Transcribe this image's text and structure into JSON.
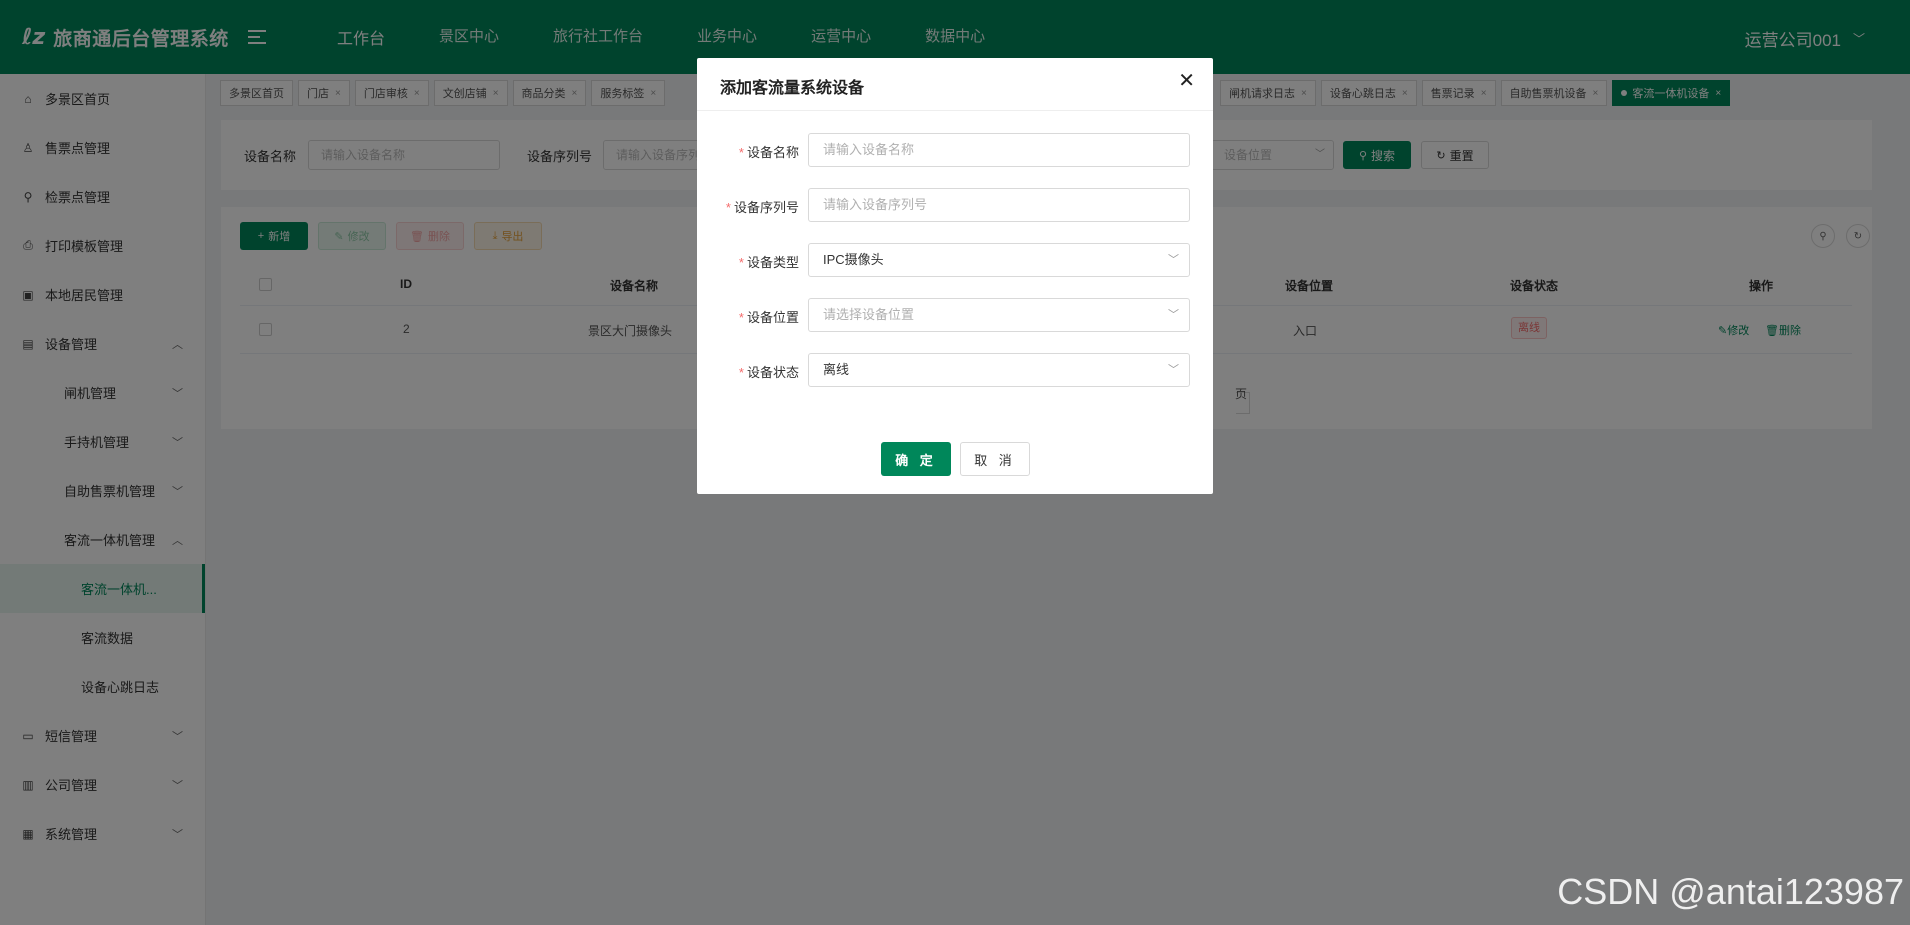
{
  "app": {
    "logo_mark": "lz",
    "title": "旅商通后台管理系统"
  },
  "top_nav": [
    "工作台",
    "景区中心",
    "旅行社工作台",
    "业务中心",
    "运营中心",
    "数据中心"
  ],
  "user": {
    "name": "运营公司001"
  },
  "sidebar": {
    "items": [
      {
        "label": "多景区首页"
      },
      {
        "label": "售票点管理"
      },
      {
        "label": "检票点管理"
      },
      {
        "label": "打印模板管理"
      },
      {
        "label": "本地居民管理"
      },
      {
        "label": "设备管理"
      },
      {
        "label": "闸机管理"
      },
      {
        "label": "手持机管理"
      },
      {
        "label": "自助售票机管理"
      },
      {
        "label": "客流一体机管理"
      },
      {
        "label": "客流一体机..."
      },
      {
        "label": "客流数据"
      },
      {
        "label": "设备心跳日志"
      },
      {
        "label": "短信管理"
      },
      {
        "label": "公司管理"
      },
      {
        "label": "系统管理"
      }
    ]
  },
  "tabs": [
    {
      "label": "多景区首页"
    },
    {
      "label": "门店"
    },
    {
      "label": "门店审核"
    },
    {
      "label": "文创店铺"
    },
    {
      "label": "商品分类"
    },
    {
      "label": "服务标签"
    },
    {
      "label": "闸机请求日志"
    },
    {
      "label": "设备心跳日志"
    },
    {
      "label": "售票记录"
    },
    {
      "label": "自助售票机设备"
    },
    {
      "label": "客流一体机设备"
    }
  ],
  "search": {
    "name_label": "设备名称",
    "name_placeholder": "请输入设备名称",
    "serial_label": "设备序列号",
    "serial_placeholder": "请输入设备序列号",
    "location_placeholder": "设备位置",
    "search_btn": "搜索",
    "reset_btn": "重置"
  },
  "toolbar": {
    "add": "新增",
    "edit": "修改",
    "delete": "删除",
    "export": "导出"
  },
  "table": {
    "headers": {
      "id": "ID",
      "name": "设备名称",
      "location": "设备位置",
      "status": "设备状态",
      "ops": "操作"
    },
    "rows": [
      {
        "id": "2",
        "name": "景区大门摄像头",
        "location": "入口",
        "status": "离线",
        "edit": "修改",
        "delete": "删除"
      }
    ],
    "pagination_suffix": "页"
  },
  "dialog": {
    "title": "添加客流量系统设备",
    "fields": {
      "name": {
        "label": "设备名称",
        "placeholder": "请输入设备名称"
      },
      "serial": {
        "label": "设备序列号",
        "placeholder": "请输入设备序列号"
      },
      "type": {
        "label": "设备类型",
        "value": "IPC摄像头"
      },
      "location": {
        "label": "设备位置",
        "placeholder": "请选择设备位置"
      },
      "status": {
        "label": "设备状态",
        "value": "离线"
      }
    },
    "confirm": "确 定",
    "cancel": "取 消"
  },
  "watermark": "CSDN @antai123987",
  "colors": {
    "brand": "#00875a",
    "danger": "#f56c6c",
    "warning": "#e6a23c"
  }
}
